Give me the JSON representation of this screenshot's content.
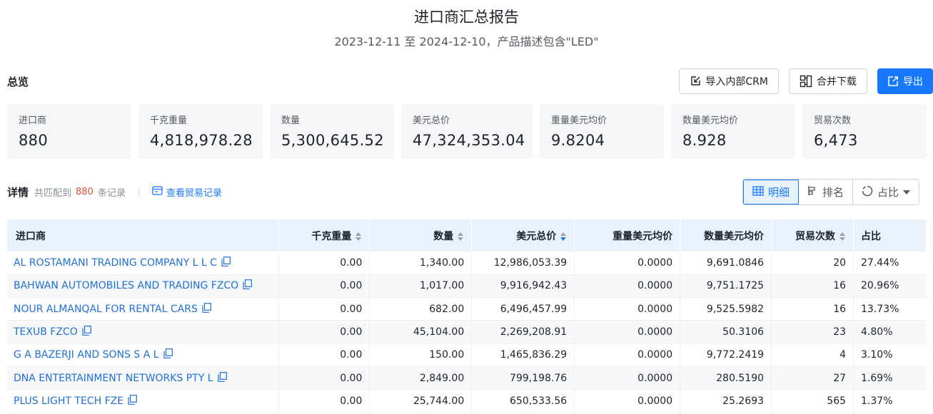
{
  "header": {
    "title": "进口商汇总报告",
    "subtitle": "2023-12-11 至 2024-12-10，产品描述包含\"LED\""
  },
  "overview_label": "总览",
  "toolbar": {
    "crm_label": "导入内部CRM",
    "merge_label": "合并下载",
    "export_label": "导出"
  },
  "stats": [
    {
      "label": "进口商",
      "value": "880"
    },
    {
      "label": "千克重量",
      "value": "4,818,978.28"
    },
    {
      "label": "数量",
      "value": "5,300,645.52"
    },
    {
      "label": "美元总价",
      "value": "47,324,353.04"
    },
    {
      "label": "重量美元均价",
      "value": "9.8204"
    },
    {
      "label": "数量美元均价",
      "value": "8.928"
    },
    {
      "label": "贸易次数",
      "value": "6,473"
    }
  ],
  "detail": {
    "label": "详情",
    "matched_prefix": "共匹配到",
    "matched_count": "880",
    "matched_suffix": "条记录",
    "view_records": "查看贸易记录"
  },
  "view_tabs": [
    {
      "label": "明细",
      "active": true
    },
    {
      "label": "排名",
      "active": false
    },
    {
      "label": "占比",
      "active": false
    }
  ],
  "table": {
    "columns": [
      "进口商",
      "千克重量",
      "数量",
      "美元总价",
      "重量美元均价",
      "数量美元均价",
      "贸易次数",
      "占比"
    ],
    "rows": [
      [
        "AL ROSTAMANI TRADING COMPANY L L C",
        "0.00",
        "1,340.00",
        "12,986,053.39",
        "0.0000",
        "9,691.0846",
        "20",
        "27.44%"
      ],
      [
        "BAHWAN AUTOMOBILES AND TRADING FZCO",
        "0.00",
        "1,017.00",
        "9,916,942.43",
        "0.0000",
        "9,751.1725",
        "16",
        "20.96%"
      ],
      [
        "NOUR ALMANQAL FOR RENTAL CARS",
        "0.00",
        "682.00",
        "6,496,457.99",
        "0.0000",
        "9,525.5982",
        "16",
        "13.73%"
      ],
      [
        "TEXUB FZCO",
        "0.00",
        "45,104.00",
        "2,269,208.91",
        "0.0000",
        "50.3106",
        "23",
        "4.80%"
      ],
      [
        "G A BAZERJI AND SONS S A L",
        "0.00",
        "150.00",
        "1,465,836.29",
        "0.0000",
        "9,772.2419",
        "4",
        "3.10%"
      ],
      [
        "DNA ENTERTAINMENT NETWORKS PTY L",
        "0.00",
        "2,849.00",
        "799,198.76",
        "0.0000",
        "280.5190",
        "27",
        "1.69%"
      ],
      [
        "PLUS LIGHT TECH FZE",
        "0.00",
        "25,744.00",
        "650,533.56",
        "0.0000",
        "25.2693",
        "565",
        "1.37%"
      ]
    ]
  },
  "colors": {
    "accent": "#1677ff",
    "header_bg": "#e9f1fd",
    "stat_bg": "#f5f6f8",
    "count_red": "#e24b3b"
  }
}
